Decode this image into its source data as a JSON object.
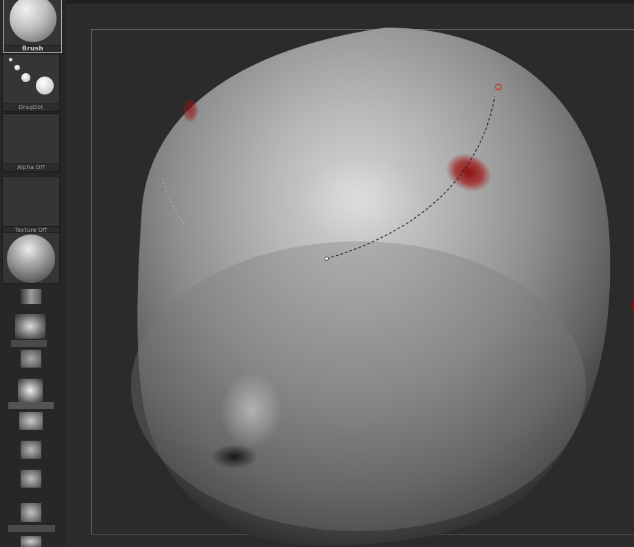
{
  "tray": {
    "brush_label": "Brush",
    "stroke_label": "DragDot",
    "alpha_label": "Alpha Off",
    "texture_label": "Texture Off"
  },
  "colors": {
    "ui_dark": "#2b2b2b",
    "tray_bg": "#262626",
    "stroke_marker": "#c0392b",
    "paint_blob": "#8b0a0a"
  }
}
